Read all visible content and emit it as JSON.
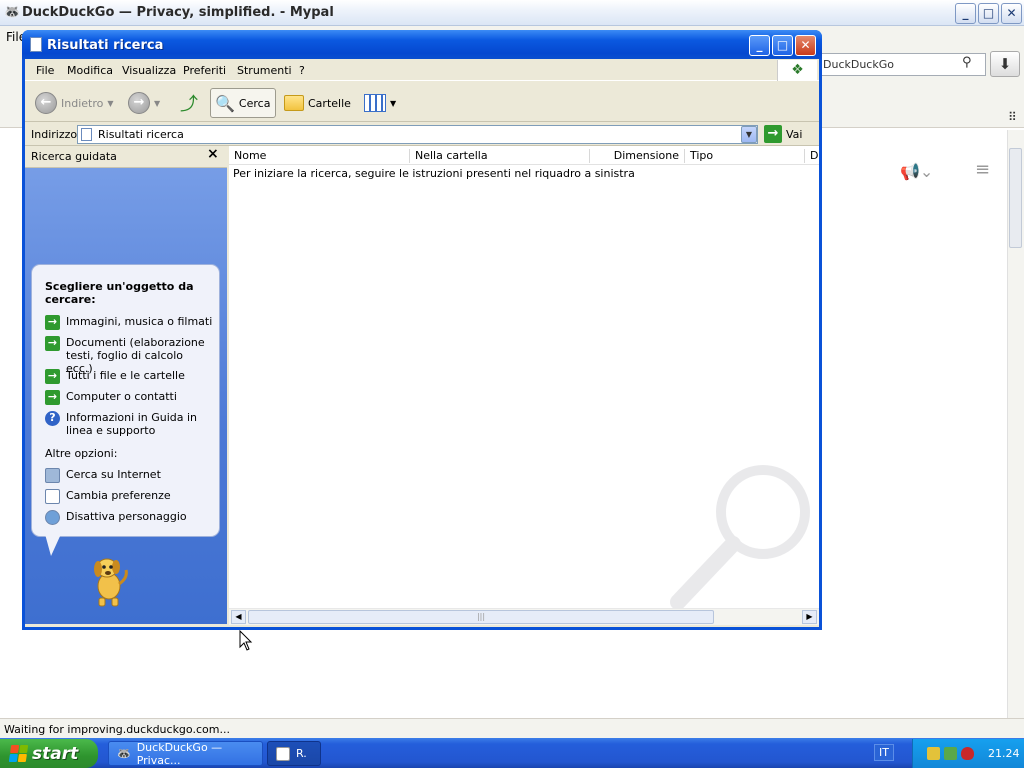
{
  "browser": {
    "title": "DuckDuckGo — Privacy, simplified. - Mypal",
    "menu_file": "File",
    "search_value": "DuckDuckGo",
    "status": "Waiting for improving.duckduckgo.com...",
    "buttons": {
      "minimize": "_",
      "maximize": "□",
      "close": "✕"
    }
  },
  "explorer": {
    "title": "Risultati ricerca",
    "menu": [
      "File",
      "Modifica",
      "Visualizza",
      "Preferiti",
      "Strumenti",
      "?"
    ],
    "toolbar": {
      "back": "Indietro",
      "search": "Cerca",
      "folders": "Cartelle"
    },
    "address": {
      "label": "Indirizzo",
      "value": "Risultati ricerca",
      "go": "Vai"
    },
    "left_pane": {
      "title": "Ricerca guidata",
      "heading": "Scegliere un'oggetto da cercare:",
      "options": [
        "Immagini, musica o filmati",
        "Documenti (elaborazione testi, foglio di calcolo ecc.)",
        "Tutti i file e le cartelle",
        "Computer o contatti",
        "Informazioni in Guida in linea e supporto"
      ],
      "other_heading": "Altre opzioni:",
      "other_options": [
        "Cerca su Internet",
        "Cambia preferenze",
        "Disattiva personaggio"
      ]
    },
    "columns": [
      "Nome",
      "Nella cartella",
      "Dimensione",
      "Tipo",
      "D"
    ],
    "hint": "Per iniziare la ricerca, seguire le istruzioni presenti nel riquadro a sinistra"
  },
  "taskbar": {
    "start": "start",
    "tasks": [
      "DuckDuckGo — Privac...",
      "R."
    ],
    "language": "IT",
    "clock": "21.24"
  },
  "colors": {
    "xp_blue": "#0a52d8",
    "start_green": "#2e942e",
    "pane_blue": "#4c79d5"
  }
}
